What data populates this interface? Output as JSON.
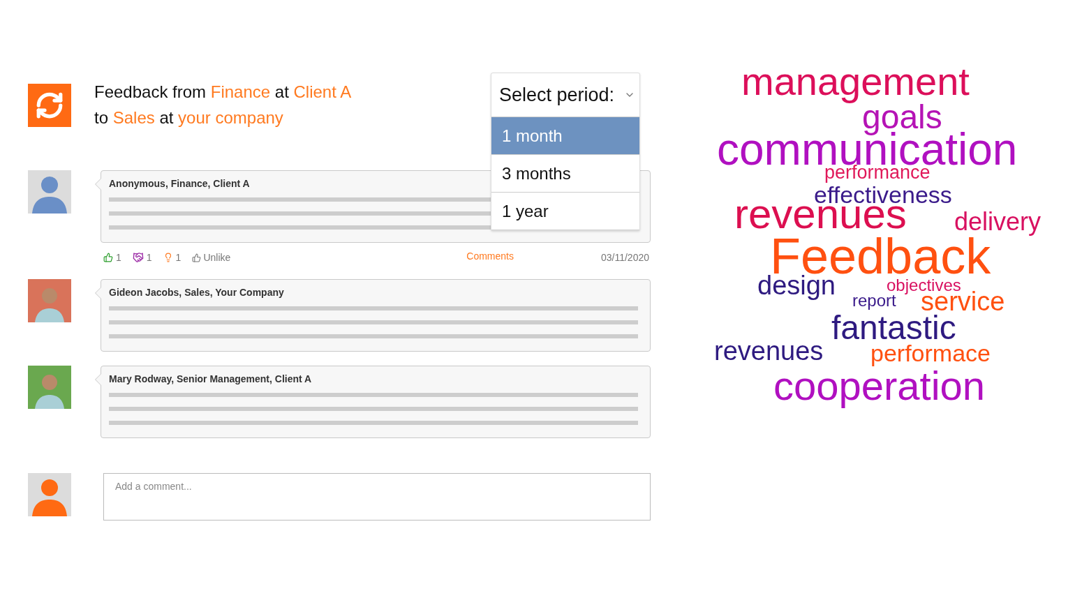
{
  "header": {
    "lines": [
      [
        {
          "text": "Feedback from",
          "accent": false
        },
        {
          "text": "Finance",
          "accent": true
        },
        {
          "text": "at",
          "accent": false
        },
        {
          "text": "Client A",
          "accent": true
        }
      ],
      [
        {
          "text": "to",
          "accent": false
        },
        {
          "text": "Sales",
          "accent": true
        },
        {
          "text": "at",
          "accent": false
        },
        {
          "text": "your company",
          "accent": true
        }
      ]
    ]
  },
  "period_select": {
    "label": "Select period:",
    "expanded": true,
    "options": [
      {
        "label": "1 month",
        "selected": true
      },
      {
        "label": "3 months",
        "selected": false
      },
      {
        "label": "1 year",
        "selected": false
      }
    ]
  },
  "comments": [
    {
      "author": "Anonymous, Finance, Client A",
      "avatar": {
        "kind": "silhouette",
        "color": "#6a8fc7"
      },
      "reactions": [
        {
          "kind": "like",
          "count": "1"
        },
        {
          "kind": "handshake",
          "count": "1"
        },
        {
          "kind": "idea",
          "count": "1"
        }
      ],
      "unlike": "Unlike",
      "comments_link": "Comments",
      "date": "03/11/2020"
    },
    {
      "author": "Gideon Jacobs, Sales, Your Company",
      "avatar": {
        "kind": "portrait",
        "color": "#d9735a"
      }
    },
    {
      "author": "Mary Rodway, Senior Management, Client A",
      "avatar": {
        "kind": "portrait",
        "color": "#6aa84f"
      }
    }
  ],
  "new_comment": {
    "placeholder": "Add a comment...",
    "avatar": {
      "kind": "silhouette",
      "color": "#ff6a13"
    }
  },
  "word_cloud": [
    {
      "text": "management",
      "color": "#dc0f5a"
    },
    {
      "text": "goals",
      "color": "#b513b5"
    },
    {
      "text": "communication",
      "color": "#b010c0"
    },
    {
      "text": "performance",
      "color": "#e0195a"
    },
    {
      "text": "effectiveness",
      "color": "#3a1a8a"
    },
    {
      "text": "revenues",
      "color": "#dc0f50"
    },
    {
      "text": "delivery",
      "color": "#d81060"
    },
    {
      "text": "Feedback",
      "color": "#ff5010"
    },
    {
      "text": "design",
      "color": "#2e1a80"
    },
    {
      "text": "objectives",
      "color": "#d81060"
    },
    {
      "text": "report",
      "color": "#3a1a8a"
    },
    {
      "text": "service",
      "color": "#ff5010"
    },
    {
      "text": "fantastic",
      "color": "#2e1a80"
    },
    {
      "text": "revenues",
      "color": "#2e1a80"
    },
    {
      "text": "performace",
      "color": "#ff5010"
    },
    {
      "text": "cooperation",
      "color": "#b010c0"
    }
  ]
}
